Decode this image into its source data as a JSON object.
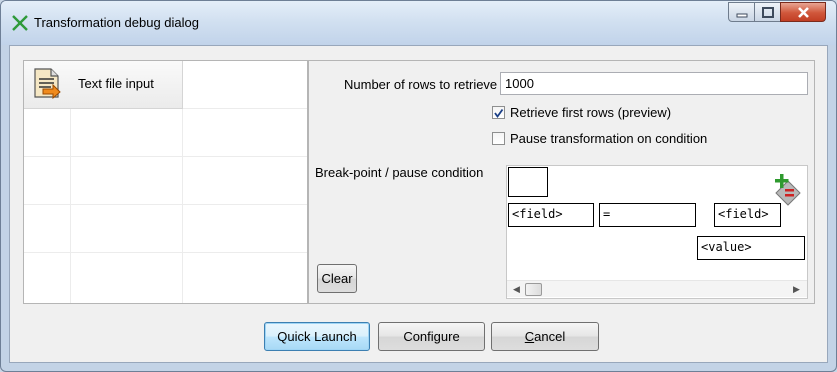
{
  "window": {
    "title": "Transformation debug dialog"
  },
  "left_panel": {
    "steps": [
      {
        "label": "Text file input",
        "icon": "text-file-input-icon"
      }
    ]
  },
  "form": {
    "rows_label": "Number of rows to retrieve",
    "rows_value": "1000",
    "retrieve_first_label": "Retrieve first rows (preview)",
    "retrieve_first_checked": true,
    "pause_label": "Pause transformation on condition",
    "pause_checked": false,
    "breakpoint_label": "Break-point / pause condition"
  },
  "condition": {
    "left_field": "<field>",
    "operator": "=",
    "right_field": "<field>",
    "value": "<value>"
  },
  "buttons": {
    "clear": "Clear",
    "quick_launch": "Quick Launch",
    "configure": "Configure",
    "cancel_prefix": "",
    "cancel_mnemonic": "C",
    "cancel_rest": "ancel"
  },
  "colors": {
    "accent": "#3c7fb1",
    "close": "#c13e24"
  }
}
